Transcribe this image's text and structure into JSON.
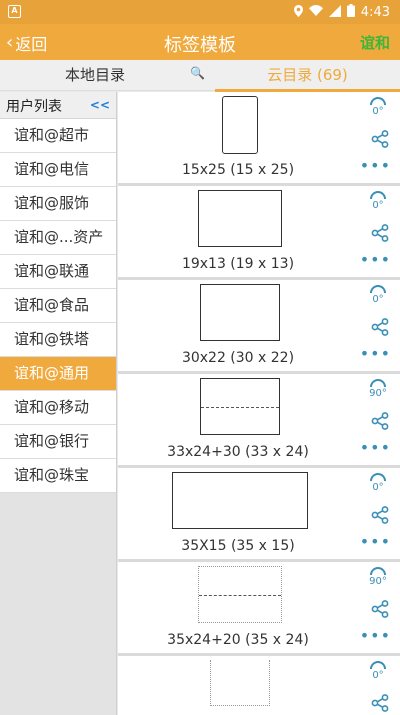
{
  "status_bar": {
    "notification_letter": "A",
    "time": "4:43"
  },
  "header": {
    "back_label": "返回",
    "title": "标签模板",
    "action_label": "谊和"
  },
  "tabs": {
    "local_label": "本地目录",
    "cloud_label": "云目录 (69)"
  },
  "sidebar": {
    "header_label": "用户列表",
    "collapse_label": "<<",
    "items": [
      {
        "label": "谊和@超市"
      },
      {
        "label": "谊和@电信"
      },
      {
        "label": "谊和@服饰"
      },
      {
        "label": "谊和@...资产"
      },
      {
        "label": "谊和@联通"
      },
      {
        "label": "谊和@食品"
      },
      {
        "label": "谊和@铁塔"
      },
      {
        "label": "谊和@通用",
        "active": true
      },
      {
        "label": "谊和@移动"
      },
      {
        "label": "谊和@银行"
      },
      {
        "label": "谊和@珠宝"
      }
    ]
  },
  "templates": [
    {
      "name": "15x25 (15 x 25)",
      "rotation": "0°"
    },
    {
      "name": "19x13 (19 x 13)",
      "rotation": "0°"
    },
    {
      "name": "30x22 (30 x 22)",
      "rotation": "0°"
    },
    {
      "name": "33x24+30 (33 x 24)",
      "rotation": "90°"
    },
    {
      "name": "35X15 (35 x 15)",
      "rotation": "0°"
    },
    {
      "name": "35x24+20 (35 x 24)",
      "rotation": "90°"
    },
    {
      "name": "",
      "rotation": "0°"
    }
  ],
  "colors": {
    "accent": "#f0a93c",
    "link_blue": "#3a8fb7",
    "action_green": "#3fb53a"
  }
}
